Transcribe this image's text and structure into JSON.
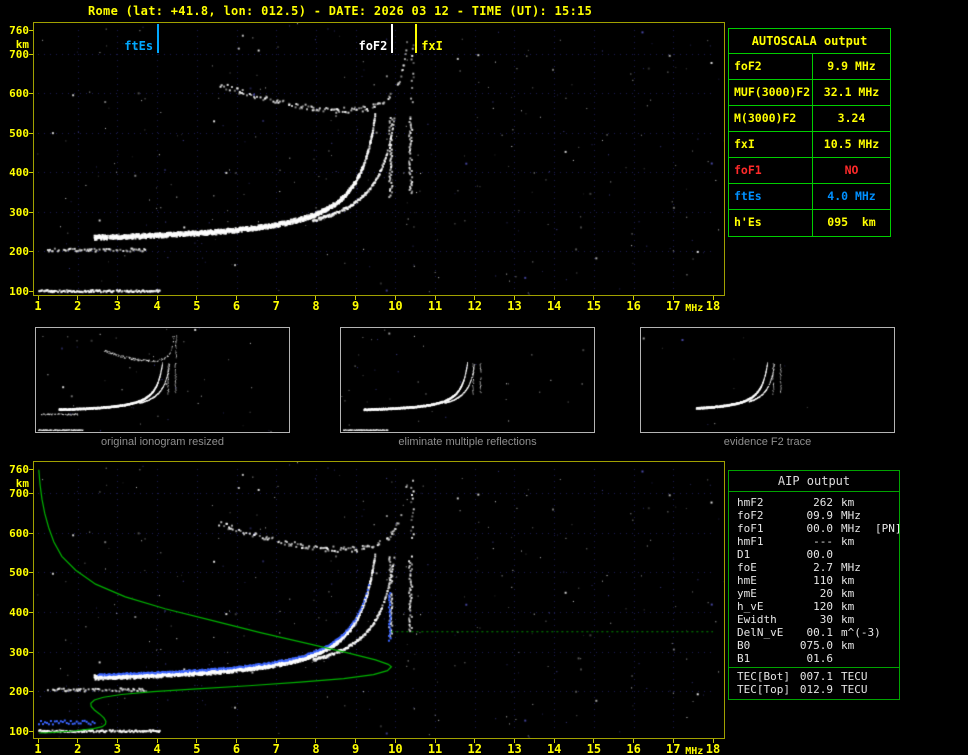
{
  "header": {
    "title": "Rome (lat: +41.8, lon: 012.5) - DATE: 2026 03 12 - TIME (UT): 15:15"
  },
  "colors": {
    "yellow": "#ffff00",
    "red": "#ff2a2a",
    "blue": "#0090ff",
    "accent_green": "#00ce00",
    "profile_green": "#00b400",
    "trace_blue": "#3a64ff",
    "axis_border": "#a0a000"
  },
  "top_plot": {
    "x_ticks": [
      "1",
      "2",
      "3",
      "4",
      "5",
      "6",
      "7",
      "8",
      "9",
      "10",
      "11",
      "12",
      "13",
      "14",
      "15",
      "16",
      "17",
      "18"
    ],
    "x_unit": "MHz",
    "y_ticks": [
      "760",
      "700",
      "600",
      "500",
      "400",
      "300",
      "200",
      "100"
    ],
    "y_unit": "km",
    "markers": [
      {
        "label": "ftEs",
        "freq_mhz": 4.0,
        "color": "#00a8ff",
        "label_side": "left"
      },
      {
        "label": "foF2",
        "freq_mhz": 9.9,
        "color": "#ffffff",
        "label_side": "left"
      },
      {
        "label": "fxI",
        "freq_mhz": 10.5,
        "color": "#ffff00",
        "label_side": "right"
      }
    ]
  },
  "thumbnails": [
    {
      "caption": "original ionogram resized"
    },
    {
      "caption": "eliminate multiple reflections"
    },
    {
      "caption": "evidence F2 trace"
    }
  ],
  "bottom_plot": {
    "x_ticks": [
      "1",
      "2",
      "3",
      "4",
      "5",
      "6",
      "7",
      "8",
      "9",
      "10",
      "11",
      "12",
      "13",
      "14",
      "15",
      "16",
      "17",
      "18"
    ],
    "x_unit": "MHz",
    "y_ticks": [
      "760",
      "700",
      "600",
      "500",
      "400",
      "300",
      "200",
      "100"
    ],
    "y_unit": "km",
    "dotted_line_h_km": 350,
    "profile_points": [
      [
        1.02,
        758
      ],
      [
        1.05,
        722
      ],
      [
        1.1,
        684
      ],
      [
        1.17,
        648
      ],
      [
        1.27,
        612
      ],
      [
        1.4,
        576
      ],
      [
        1.6,
        540
      ],
      [
        1.95,
        505
      ],
      [
        2.45,
        470
      ],
      [
        3.2,
        438
      ],
      [
        4.2,
        408
      ],
      [
        5.4,
        378
      ],
      [
        6.6,
        348
      ],
      [
        7.8,
        320
      ],
      [
        8.8,
        297
      ],
      [
        9.5,
        279
      ],
      [
        9.82,
        268
      ],
      [
        9.9,
        262
      ],
      [
        9.8,
        252
      ],
      [
        9.45,
        242
      ],
      [
        8.7,
        232
      ],
      [
        7.6,
        223
      ],
      [
        6.3,
        214
      ],
      [
        5.0,
        206
      ],
      [
        3.9,
        199
      ],
      [
        3.1,
        192
      ],
      [
        2.65,
        185
      ],
      [
        2.42,
        178
      ],
      [
        2.33,
        170
      ],
      [
        2.34,
        162
      ],
      [
        2.42,
        153
      ],
      [
        2.55,
        143
      ],
      [
        2.66,
        133
      ],
      [
        2.71,
        124
      ],
      [
        2.7,
        117
      ],
      [
        2.62,
        111
      ],
      [
        2.4,
        106
      ],
      [
        1.9,
        100
      ],
      [
        1.3,
        96
      ],
      [
        1.02,
        95
      ]
    ]
  },
  "autoscala": {
    "title": "AUTOSCALA output",
    "rows": [
      {
        "label": "foF2",
        "value": "9.9 MHz",
        "color": "#ffff00"
      },
      {
        "label": "MUF(3000)F2",
        "value": "32.1 MHz",
        "color": "#ffff00"
      },
      {
        "label": "M(3000)F2",
        "value": "3.24",
        "color": "#ffff00"
      },
      {
        "label": "fxI",
        "value": "10.5 MHz",
        "color": "#ffff00"
      },
      {
        "label": "foF1",
        "value": "NO",
        "color": "#ff2a2a"
      },
      {
        "label": "ftEs",
        "value": "4.0 MHz",
        "color": "#0090ff"
      },
      {
        "label": "h'Es",
        "value": "095  km",
        "color": "#ffff00"
      }
    ]
  },
  "aip": {
    "title": "AIP output",
    "rows": [
      {
        "label": "hmF2",
        "value": "262",
        "unit": "km"
      },
      {
        "label": "foF2",
        "value": "09.9",
        "unit": "MHz"
      },
      {
        "label": "foF1",
        "value": "00.0",
        "unit": "MHz",
        "note": "[PN]"
      },
      {
        "label": "hmF1",
        "value": "---",
        "unit": "km"
      },
      {
        "label": "D1",
        "value": "00.0",
        "unit": ""
      },
      {
        "label": "foE",
        "value": "2.7",
        "unit": "MHz"
      },
      {
        "label": "hmE",
        "value": "110",
        "unit": "km"
      },
      {
        "label": "ymE",
        "value": "20",
        "unit": "km"
      },
      {
        "label": "h_vE",
        "value": "120",
        "unit": "km"
      },
      {
        "label": "Ewidth",
        "value": "30",
        "unit": "km"
      },
      {
        "label": "DelN_vE",
        "value": "00.1",
        "unit": "m^(-3)"
      },
      {
        "label": "B0",
        "value": "075.0",
        "unit": "km"
      },
      {
        "label": "B1",
        "value": "01.6",
        "unit": ""
      }
    ],
    "tec_rows": [
      {
        "label": "TEC[Bot]",
        "value": "007.1",
        "unit": "TECU"
      },
      {
        "label": "TEC[Top]",
        "value": "012.9",
        "unit": "TECU"
      }
    ]
  }
}
